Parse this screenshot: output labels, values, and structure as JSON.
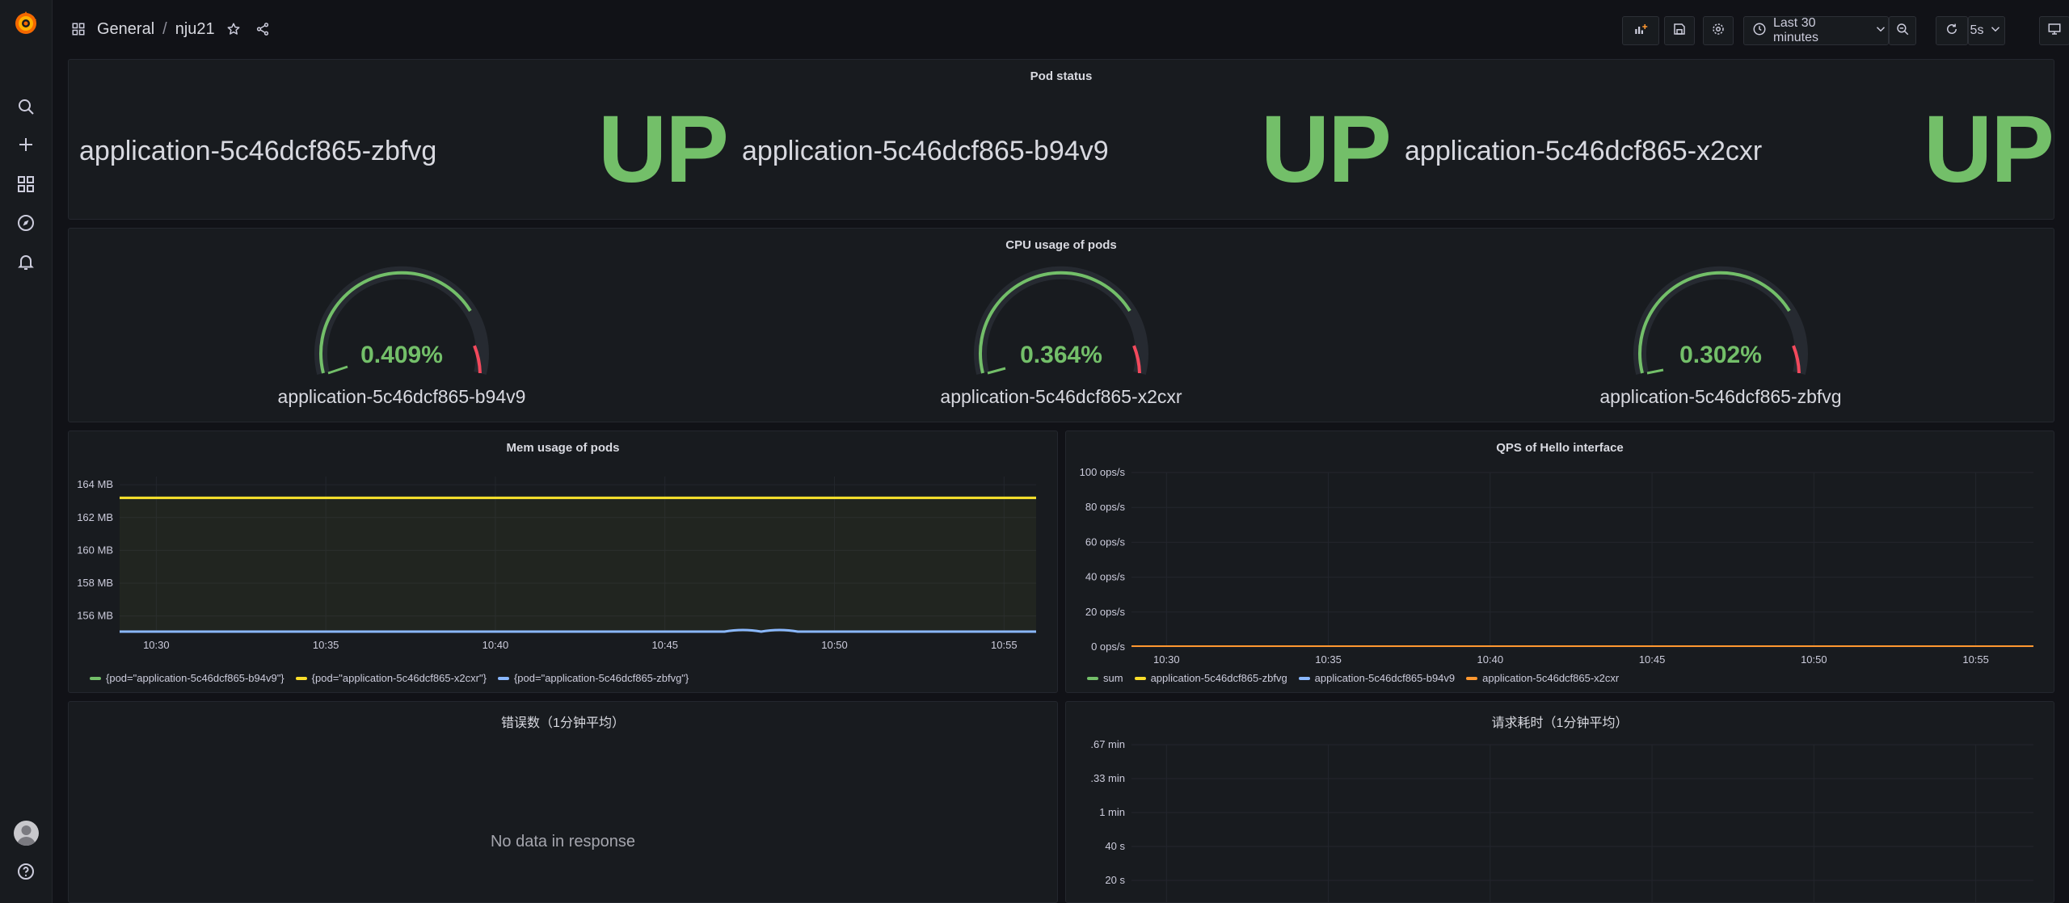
{
  "breadcrumb": {
    "folder": "General",
    "separator": "/",
    "dashboard": "nju21"
  },
  "toolbar": {
    "time_range": "Last 30 minutes",
    "refresh_interval": "5s"
  },
  "colors": {
    "green": "#73bf69",
    "yellow": "#fade2a",
    "blue": "#8ab8ff",
    "orange": "#ff9830",
    "red": "#f2495c"
  },
  "pod_status": {
    "title": "Pod status",
    "items": [
      {
        "name": "application-5c46dcf865-zbfvg",
        "status": "UP"
      },
      {
        "name": "application-5c46dcf865-b94v9",
        "status": "UP"
      },
      {
        "name": "application-5c46dcf865-x2cxr",
        "status": "UP"
      }
    ]
  },
  "cpu": {
    "title": "CPU usage of pods",
    "gauges": [
      {
        "name": "application-5c46dcf865-b94v9",
        "value": "0.409%"
      },
      {
        "name": "application-5c46dcf865-x2cxr",
        "value": "0.364%"
      },
      {
        "name": "application-5c46dcf865-zbfvg",
        "value": "0.302%"
      }
    ]
  },
  "mem": {
    "title": "Mem usage of pods",
    "legend": [
      {
        "label": "{pod=\"application-5c46dcf865-b94v9\"}",
        "color": "#73bf69"
      },
      {
        "label": "{pod=\"application-5c46dcf865-x2cxr\"}",
        "color": "#fade2a"
      },
      {
        "label": "{pod=\"application-5c46dcf865-zbfvg\"}",
        "color": "#8ab8ff"
      }
    ]
  },
  "qps": {
    "title": "QPS of Hello interface",
    "legend": [
      {
        "label": "sum",
        "color": "#73bf69"
      },
      {
        "label": "application-5c46dcf865-zbfvg",
        "color": "#fade2a"
      },
      {
        "label": "application-5c46dcf865-b94v9",
        "color": "#8ab8ff"
      },
      {
        "label": "application-5c46dcf865-x2cxr",
        "color": "#ff9830"
      }
    ]
  },
  "errors": {
    "title": "错误数（1分钟平均）",
    "empty": "No data in response"
  },
  "latency": {
    "title": "请求耗时（1分钟平均）"
  },
  "chart_data": [
    {
      "type": "line",
      "title": "Mem usage of pods",
      "x": [
        "10:30",
        "10:35",
        "10:40",
        "10:45",
        "10:50",
        "10:55"
      ],
      "yticks": [
        "164 MB",
        "162 MB",
        "160 MB",
        "158 MB",
        "156 MB"
      ],
      "ylim": [
        155,
        164.5
      ],
      "series": [
        {
          "name": "{pod=\"application-5c46dcf865-b94v9\"}",
          "values": [
            163.2,
            163.2,
            163.2,
            163.2,
            163.2,
            163.2
          ]
        },
        {
          "name": "{pod=\"application-5c46dcf865-x2cxr\"}",
          "values": [
            163.2,
            163.2,
            163.2,
            163.2,
            163.2,
            163.2
          ]
        },
        {
          "name": "{pod=\"application-5c46dcf865-zbfvg\"}",
          "values": [
            155.0,
            155.0,
            155.0,
            155.0,
            155.05,
            155.0
          ]
        }
      ]
    },
    {
      "type": "line",
      "title": "QPS of Hello interface",
      "x": [
        "10:30",
        "10:35",
        "10:40",
        "10:45",
        "10:50",
        "10:55"
      ],
      "yticks": [
        "100 ops/s",
        "80 ops/s",
        "60 ops/s",
        "40 ops/s",
        "20 ops/s",
        "0 ops/s"
      ],
      "ylim": [
        0,
        100
      ],
      "series": [
        {
          "name": "sum",
          "values": [
            0,
            0,
            0,
            0,
            0,
            0
          ]
        },
        {
          "name": "application-5c46dcf865-zbfvg",
          "values": [
            0,
            0,
            0,
            0,
            0,
            0
          ]
        },
        {
          "name": "application-5c46dcf865-b94v9",
          "values": [
            0,
            0,
            0,
            0,
            0,
            0
          ]
        },
        {
          "name": "application-5c46dcf865-x2cxr",
          "values": [
            0,
            0,
            0,
            0,
            0,
            0
          ]
        }
      ]
    },
    {
      "type": "line",
      "title": "请求耗时（1分钟平均）",
      "yticks": [
        ".67 min",
        ".33 min",
        "1 min",
        "40 s",
        "20 s"
      ],
      "series": []
    }
  ]
}
